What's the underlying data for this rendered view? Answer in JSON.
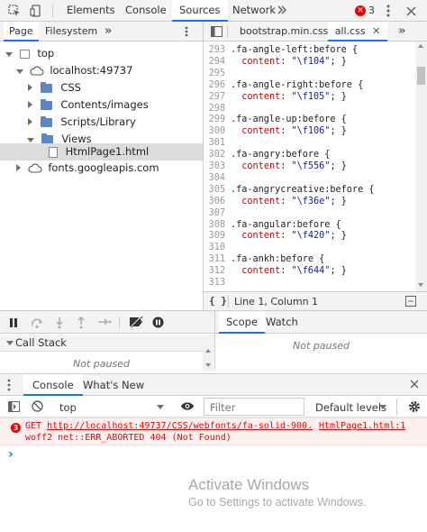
{
  "toolbar": {
    "tabs": [
      "Elements",
      "Console",
      "Sources",
      "Network"
    ],
    "error_count": "3"
  },
  "navigator": {
    "tabs": [
      "Page",
      "Filesystem"
    ],
    "more": "»",
    "tree": [
      {
        "label": "top"
      },
      {
        "label": "localhost:49737"
      },
      {
        "label": "CSS"
      },
      {
        "label": "Contents/images"
      },
      {
        "label": "Scripts/Library"
      },
      {
        "label": "Views"
      },
      {
        "label": "HtmlPage1.html"
      },
      {
        "label": "fonts.googleapis.com"
      }
    ]
  },
  "editor": {
    "tabs": [
      "bootstrap.min.css",
      "all.css"
    ],
    "more": "»",
    "lines": [
      {
        "n": "293",
        "sel": ".fa-angle-left:before {",
        "prop": "",
        "val": ""
      },
      {
        "n": "294",
        "sel": "",
        "prop": "content",
        "val": "\"\\f104\""
      },
      {
        "n": "295",
        "sel": "",
        "prop": "",
        "val": ""
      },
      {
        "n": "296",
        "sel": ".fa-angle-right:before {",
        "prop": "",
        "val": ""
      },
      {
        "n": "297",
        "sel": "",
        "prop": "content",
        "val": "\"\\f105\""
      },
      {
        "n": "298",
        "sel": "",
        "prop": "",
        "val": ""
      },
      {
        "n": "299",
        "sel": ".fa-angle-up:before {",
        "prop": "",
        "val": ""
      },
      {
        "n": "300",
        "sel": "",
        "prop": "content",
        "val": "\"\\f106\""
      },
      {
        "n": "301",
        "sel": "",
        "prop": "",
        "val": ""
      },
      {
        "n": "302",
        "sel": ".fa-angry:before {",
        "prop": "",
        "val": ""
      },
      {
        "n": "303",
        "sel": "",
        "prop": "content",
        "val": "\"\\f556\""
      },
      {
        "n": "304",
        "sel": "",
        "prop": "",
        "val": ""
      },
      {
        "n": "305",
        "sel": ".fa-angrycreative:before {",
        "prop": "",
        "val": ""
      },
      {
        "n": "306",
        "sel": "",
        "prop": "content",
        "val": "\"\\f36e\""
      },
      {
        "n": "307",
        "sel": "",
        "prop": "",
        "val": ""
      },
      {
        "n": "308",
        "sel": ".fa-angular:before {",
        "prop": "",
        "val": ""
      },
      {
        "n": "309",
        "sel": "",
        "prop": "content",
        "val": "\"\\f420\""
      },
      {
        "n": "310",
        "sel": "",
        "prop": "",
        "val": ""
      },
      {
        "n": "311",
        "sel": ".fa-ankh:before {",
        "prop": "",
        "val": ""
      },
      {
        "n": "312",
        "sel": "",
        "prop": "content",
        "val": "\"\\f644\""
      },
      {
        "n": "313",
        "sel": "",
        "prop": "",
        "val": ""
      }
    ],
    "status": "Line 1, Column 1",
    "pretty_print": "{ }"
  },
  "debugger": {
    "scope_tab": "Scope",
    "watch_tab": "Watch",
    "not_paused_right": "Not paused",
    "call_stack": "Call Stack",
    "not_paused_left": "Not paused"
  },
  "drawer": {
    "tabs": [
      "Console",
      "What's New"
    ],
    "context": "top",
    "filter_placeholder": "Filter",
    "levels": "Default levels",
    "error_badge": "3",
    "error_prefix": "GET ",
    "error_url": "http://localhost:49737/CSS/webfonts/fa-solid-900.",
    "error_source": "HtmlPage1.html:1",
    "error_line2": "woff2 net::ERR_ABORTED 404 (Not Found)",
    "prompt": "›"
  },
  "watermark": {
    "title": "Activate Windows",
    "subtitle": "Go to Settings to activate Windows."
  },
  "colors": {
    "accent": "#1a73e8",
    "error": "#e00000",
    "folder": "#5b87c6"
  }
}
